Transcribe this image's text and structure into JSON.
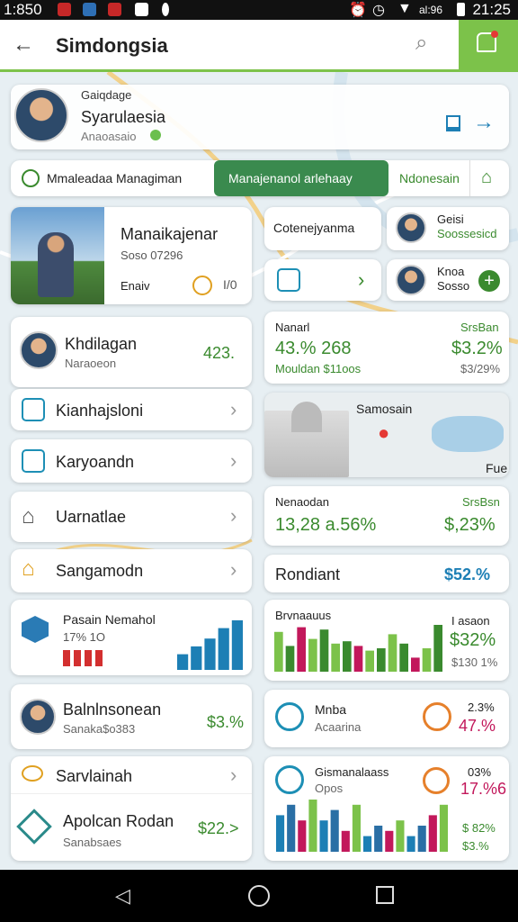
{
  "status": {
    "time": "1:850",
    "clock": "21:25",
    "signal": "al:96"
  },
  "appbar": {
    "title": "Simdongsia",
    "bg_accent": "#7cc24a"
  },
  "profile": {
    "small_label": "Gaiqdage",
    "name": "Syarulaesia",
    "sub": "Anaoasaio"
  },
  "tabs": [
    {
      "label": "Mmaleadaa Managiman"
    },
    {
      "label": "Manajenanol arlehaay"
    },
    {
      "label": "Ndonesain"
    }
  ],
  "featured": {
    "title": "Manaikajenar",
    "sub": "Soso 07296",
    "footer": "Enaiv",
    "page": "I/0"
  },
  "right_top": {
    "search_label": "Cotenejyanma",
    "user1": {
      "name": "Geisi",
      "sub": "Soossesicd"
    },
    "user2": {
      "name": "Knoa",
      "sub": "Sosso"
    }
  },
  "left_list": {
    "person": {
      "name": "Khdilagan",
      "sub": "Naraoeon",
      "value": "423."
    },
    "items": [
      {
        "label": "Kianhajsloni",
        "icon": "chart-icon"
      },
      {
        "label": "Karyoandn",
        "icon": "money-icon"
      },
      {
        "label": "Uarnatlae",
        "icon": "home-icon"
      },
      {
        "label": "Sangamodn",
        "icon": "house-icon"
      }
    ]
  },
  "stat1": {
    "label": "Nanarl",
    "left_value": "43.% 268",
    "left_sub": "Mouldan $11oos",
    "right_label": "SrsBan",
    "right_value": "$3.2%",
    "right_sub": "$3/29%"
  },
  "map_card": {
    "label": "Samosain",
    "corner": "Fue"
  },
  "stat2": {
    "label": "Nenaodan",
    "value": "13,28 a.56%",
    "right_label": "SrsBsn",
    "right_value": "$,23%"
  },
  "stat3": {
    "label": "Rondiant",
    "value": "$52.%"
  },
  "chart_left": {
    "title": "Pasain Nemahol",
    "sub": "17% 1O"
  },
  "chart_right": {
    "title": "Brvnaauus",
    "right_label": "I asaon",
    "right_value": "$32%",
    "right_sub": "$130 1%"
  },
  "bottom_left": {
    "person": {
      "name": "Balnlnsonean",
      "sub": "Sanaka$o383",
      "value": "$3.%"
    },
    "item": {
      "label": "Sarvlainah"
    },
    "final": {
      "name": "Apolcan Rodan",
      "sub": "Sanabsaes",
      "value": "$22.>"
    }
  },
  "bottom_right": {
    "row1": {
      "name": "Mnba",
      "sub": "Acaarina",
      "top": "2.3%",
      "value": "47.%"
    },
    "row2": {
      "name": "Gismanalaass",
      "sub": "Opos",
      "top": "03%",
      "value": "17.%6",
      "bottom_value": "$3.%",
      "side": "$ 82%"
    }
  },
  "chart_data": {
    "type": "bar",
    "bars_left": [
      0.3,
      0.45,
      0.6,
      0.8,
      0.95
    ],
    "bars_right": [
      0.85,
      0.55,
      0.95,
      0.7,
      0.9,
      0.6,
      0.65,
      0.55,
      0.45,
      0.5,
      0.8,
      0.6,
      0.3,
      0.5,
      1.0
    ],
    "bars_bottom": [
      0.7,
      0.9,
      0.6,
      1.0,
      0.6,
      0.8,
      0.4,
      0.9,
      0.3,
      0.5,
      0.4,
      0.6,
      0.3,
      0.5,
      0.7,
      0.9
    ]
  }
}
